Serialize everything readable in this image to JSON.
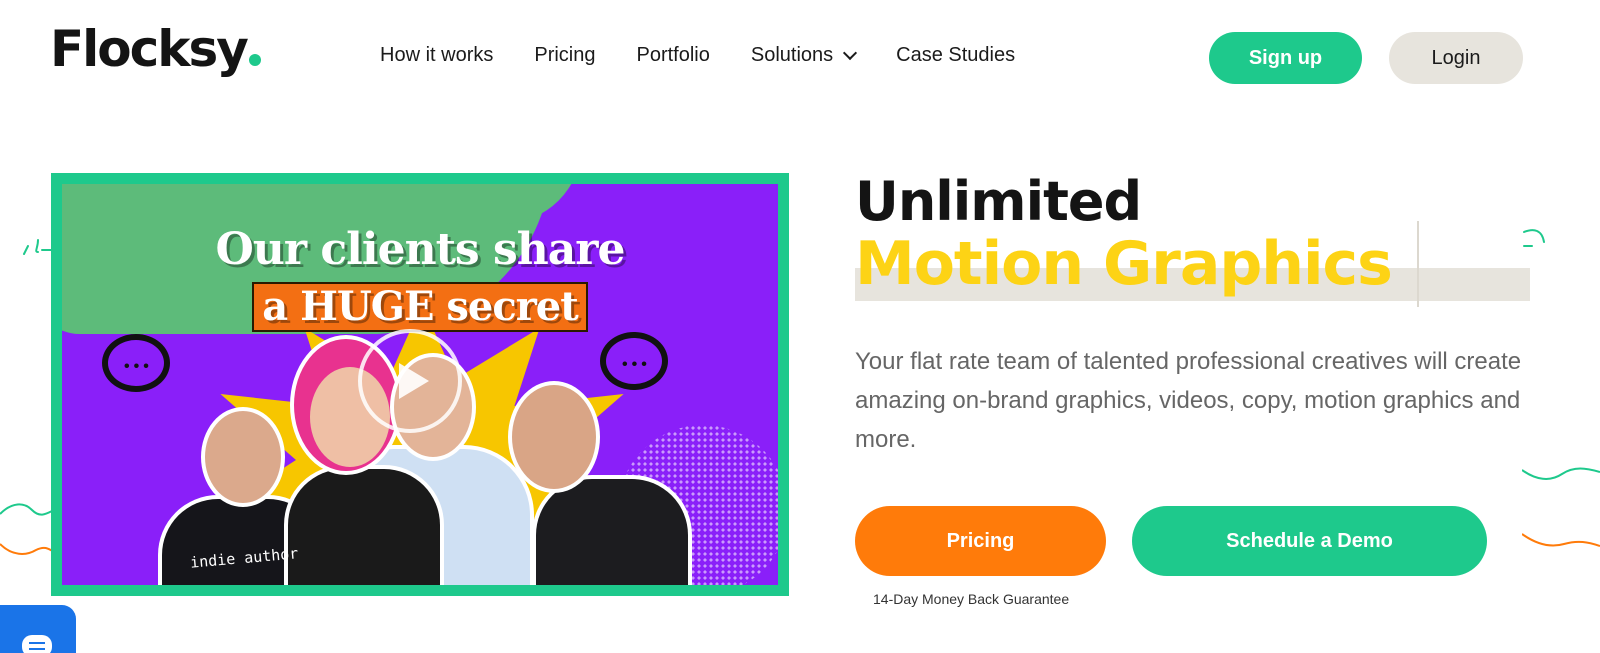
{
  "header": {
    "logo_text": "Flocksy",
    "nav": [
      "How it works",
      "Pricing",
      "Portfolio",
      "Solutions",
      "Case Studies"
    ],
    "signup_label": "Sign up",
    "login_label": "Login"
  },
  "video": {
    "headline_line1": "Our clients share",
    "headline_line2": "a HUGE secret",
    "shirt_text": "indie author"
  },
  "hero": {
    "title_line1": "Unlimited",
    "title_line2": "Motion Graphics",
    "description": "Your flat rate team of talented professional creatives will create amazing on-brand graphics, videos, copy, motion graphics and more.",
    "pricing_button": "Pricing",
    "demo_button": "Schedule a Demo",
    "guarantee": "14-Day Money Back Guarantee"
  },
  "colors": {
    "brand_green": "#1ec98c",
    "accent_orange": "#ff7b0a",
    "accent_yellow": "#fdd315",
    "video_purple": "#8a1ff9",
    "chat_blue": "#1a74e8"
  },
  "icons": {
    "nav_solutions": "chevron-down-icon",
    "video": "play-icon",
    "chat": "chat-icon"
  }
}
